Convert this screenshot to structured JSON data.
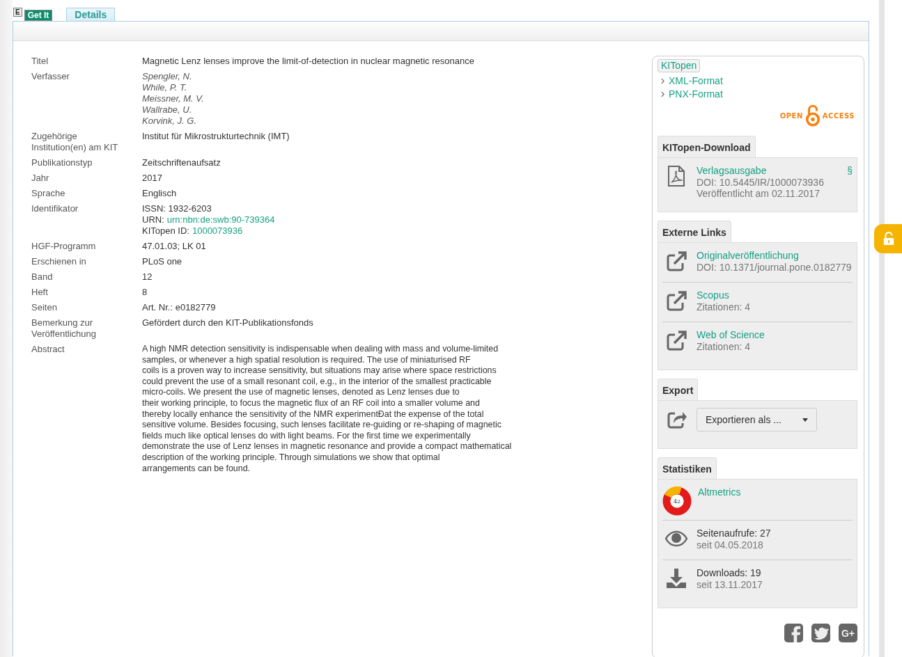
{
  "e_badge": "E",
  "tabs": [
    {
      "label": "Get It",
      "selected": false
    },
    {
      "label": "Details",
      "selected": true
    }
  ],
  "fields": [
    {
      "label": "Titel",
      "kind": "text",
      "value": "Magnetic Lenz lenses improve the limit-of-detection in nuclear magnetic resonance"
    },
    {
      "label": "Verfasser",
      "kind": "names",
      "values": [
        "Spengler, N.",
        "While, P. T.",
        "Meissner, M. V.",
        "Wallrabe, U.",
        "Korvink, J. G."
      ]
    },
    {
      "label": "Zugehörige Institution(en) am KIT",
      "kind": "text",
      "value": "Institut für Mikrostrukturtechnik (IMT)"
    },
    {
      "label": "Publikationstyp",
      "kind": "text",
      "value": "Zeitschriftenaufsatz"
    },
    {
      "label": "Jahr",
      "kind": "text",
      "value": "2017"
    },
    {
      "label": "Sprache",
      "kind": "text",
      "value": "Englisch"
    },
    {
      "label": "Identifikator",
      "kind": "lines",
      "lines": [
        {
          "prefix": "ISSN: 1932-6203"
        },
        {
          "prefix": "URN:",
          "link": "urn:nbn:de:swb:90-739364"
        },
        {
          "prefix": "KITopen ID:",
          "link": "1000073936"
        }
      ]
    },
    {
      "label": "HGF-Programm",
      "kind": "text",
      "value": "47.01.03; LK 01"
    },
    {
      "label": "Erschienen in",
      "kind": "text",
      "value": "PLoS one"
    },
    {
      "label": "Band",
      "kind": "text",
      "value": "12"
    },
    {
      "label": "Heft",
      "kind": "text",
      "value": "8"
    },
    {
      "label": "Seiten",
      "kind": "text",
      "value": "Art. Nr.: e0182779"
    },
    {
      "label": "Bemerkung zur Veröffentlichung",
      "kind": "text",
      "value": "Gefördert durch den KIT-Publikationsfonds"
    },
    {
      "label": "Abstract",
      "kind": "paragraph",
      "lines": [
        "A high NMR detection sensitivity is indispensable when dealing with mass and volume-limited",
        "samples, or whenever a high spatial resolution is required. The use of miniaturised RF",
        "coils is a proven way to increase sensitivity, but situations may arise where space restrictions",
        "could prevent the use of a small resonant coil, e.g., in the interior of the smallest practicable",
        "micro-coils. We present the use of magnetic lenses, denoted as Lenz lenses due to",
        "their working principle, to focus the magnetic flux of an RF coil into a smaller volume and",
        "thereby locally enhance the sensitivity of the NMR experimentĐat the expense of the total",
        "sensitive volume. Besides focusing, such lenses facilitate re-guiding or re-shaping of magnetic",
        "fields much like optical lenses do with light beams. For the first time we experimentally",
        "demonstrate the use of Lenz lenses in magnetic resonance and provide a compact mathematical",
        "description of the working principle. Through simulations we show that optimal",
        "arrangements can be found."
      ]
    }
  ],
  "sidebar": {
    "badge": "KITopen",
    "links": [
      "XML-Format",
      "PNX-Format"
    ],
    "open_access": {
      "left": "OPEN",
      "right": "ACCESS"
    },
    "sections": [
      {
        "title": "KITopen-Download",
        "items": [
          {
            "kind": "pdf",
            "link": "Verlagsausgabe",
            "mark": "§",
            "lines": [
              "DOI: 10.5445/IR/1000073936",
              "Veröffentlicht am 02.11.2017"
            ]
          }
        ]
      },
      {
        "title": "Externe Links",
        "items": [
          {
            "kind": "external",
            "link": "Originalveröffentlichung",
            "lines": [
              "DOI: 10.1371/journal.pone.0182779"
            ]
          },
          {
            "kind": "external",
            "link": "Scopus",
            "lines": [
              "Zitationen: 4"
            ]
          },
          {
            "kind": "external",
            "link": "Web of Science",
            "lines": [
              "Zitationen: 4"
            ]
          }
        ]
      },
      {
        "title": "Export",
        "items": [
          {
            "kind": "export",
            "dropdown": "Exportieren als ..."
          }
        ]
      },
      {
        "title": "Statistiken",
        "items": [
          {
            "kind": "altmetric",
            "badge": "42",
            "link": "Altmetrics"
          },
          {
            "kind": "views",
            "text": "Seitenaufrufe: 27",
            "lines": [
              "seit 04.05.2018"
            ]
          },
          {
            "kind": "downloads",
            "text": "Downloads: 19",
            "lines": [
              "seit 13.11.2017"
            ]
          }
        ]
      }
    ],
    "social": [
      {
        "kind": "facebook"
      },
      {
        "kind": "twitter"
      },
      {
        "kind": "googleplus",
        "label": "G+"
      }
    ]
  }
}
